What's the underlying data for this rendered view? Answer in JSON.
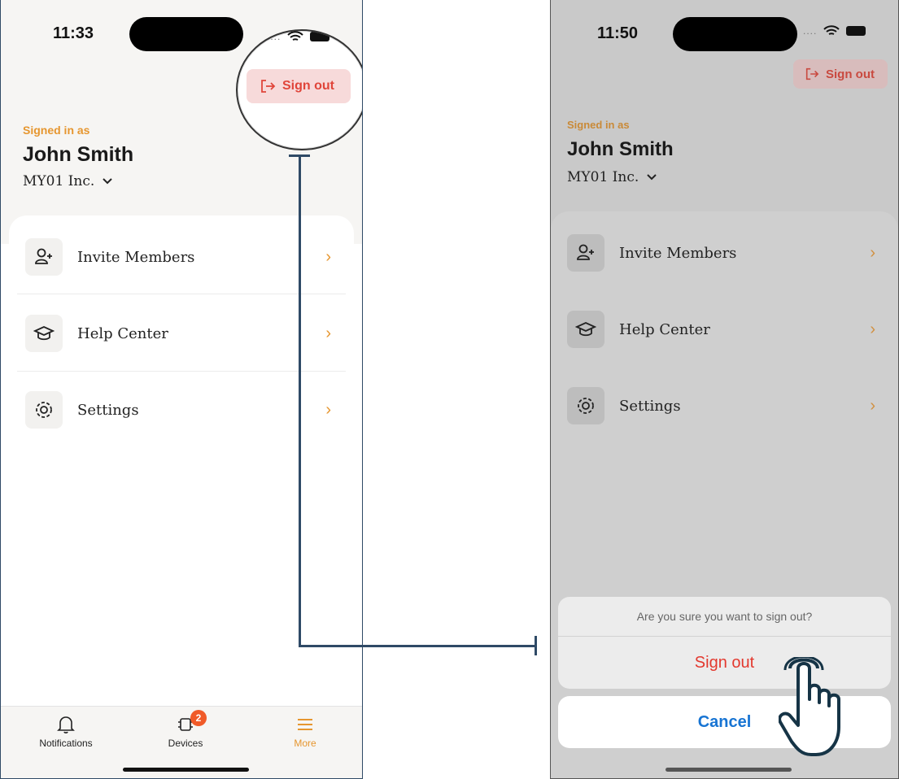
{
  "left_screen": {
    "status_time": "11:33",
    "sign_out_label": "Sign out",
    "signed_in_label": "Signed in as",
    "user_name": "John Smith",
    "org_name": "MY01 Inc.",
    "menu": [
      {
        "label": "Invite Members",
        "icon": "add-person-icon"
      },
      {
        "label": "Help Center",
        "icon": "graduation-cap-icon"
      },
      {
        "label": "Settings",
        "icon": "gear-icon"
      }
    ],
    "tabs": [
      {
        "label": "Notifications",
        "icon": "bell-icon"
      },
      {
        "label": "Devices",
        "icon": "chip-icon",
        "badge": "2"
      },
      {
        "label": "More",
        "icon": "menu-icon",
        "active": true
      }
    ]
  },
  "right_screen": {
    "status_time": "11:50",
    "sign_out_label": "Sign out",
    "signed_in_label": "Signed in as",
    "user_name": "John Smith",
    "org_name": "MY01 Inc.",
    "menu": [
      {
        "label": "Invite Members"
      },
      {
        "label": "Help Center"
      },
      {
        "label": "Settings"
      }
    ],
    "dialog": {
      "message": "Are you sure you want to sign out?",
      "confirm_label": "Sign out",
      "cancel_label": "Cancel"
    }
  },
  "colors": {
    "accent": "#e6962f",
    "danger": "#e0453a",
    "cancel": "#1774d3",
    "badge": "#f05a28"
  }
}
